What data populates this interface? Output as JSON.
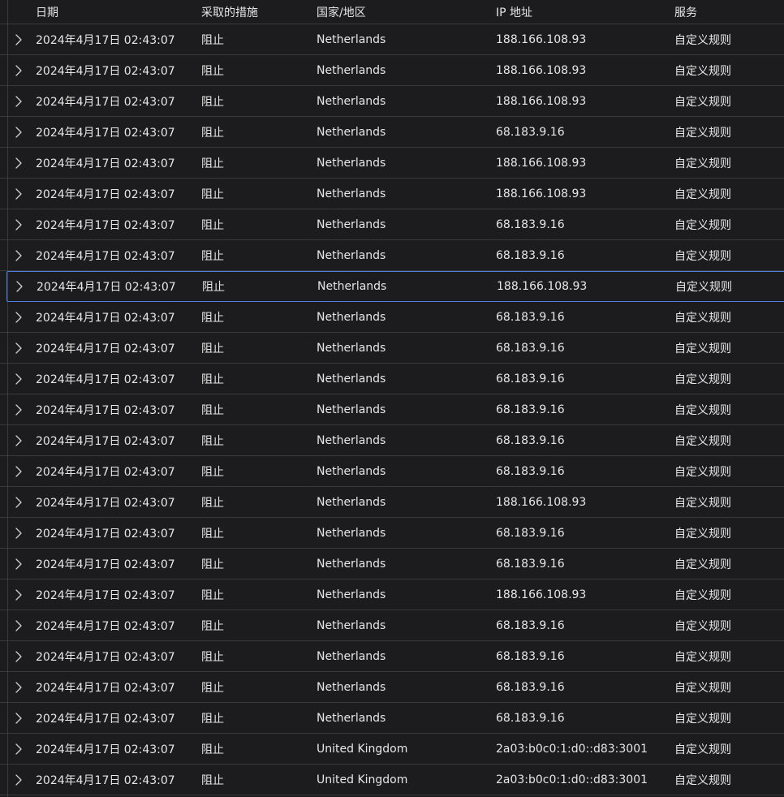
{
  "table": {
    "columns": {
      "date": "日期",
      "action": "采取的措施",
      "country": "国家/地区",
      "ip": "IP 地址",
      "service": "服务"
    },
    "selected_row_index": 8,
    "rows": [
      {
        "date": "2024年4月17日 02:43:07",
        "action": "阻止",
        "country": "Netherlands",
        "ip": "188.166.108.93",
        "service": "自定义规则"
      },
      {
        "date": "2024年4月17日 02:43:07",
        "action": "阻止",
        "country": "Netherlands",
        "ip": "188.166.108.93",
        "service": "自定义规则"
      },
      {
        "date": "2024年4月17日 02:43:07",
        "action": "阻止",
        "country": "Netherlands",
        "ip": "188.166.108.93",
        "service": "自定义规则"
      },
      {
        "date": "2024年4月17日 02:43:07",
        "action": "阻止",
        "country": "Netherlands",
        "ip": "68.183.9.16",
        "service": "自定义规则"
      },
      {
        "date": "2024年4月17日 02:43:07",
        "action": "阻止",
        "country": "Netherlands",
        "ip": "188.166.108.93",
        "service": "自定义规则"
      },
      {
        "date": "2024年4月17日 02:43:07",
        "action": "阻止",
        "country": "Netherlands",
        "ip": "188.166.108.93",
        "service": "自定义规则"
      },
      {
        "date": "2024年4月17日 02:43:07",
        "action": "阻止",
        "country": "Netherlands",
        "ip": "68.183.9.16",
        "service": "自定义规则"
      },
      {
        "date": "2024年4月17日 02:43:07",
        "action": "阻止",
        "country": "Netherlands",
        "ip": "68.183.9.16",
        "service": "自定义规则"
      },
      {
        "date": "2024年4月17日 02:43:07",
        "action": "阻止",
        "country": "Netherlands",
        "ip": "188.166.108.93",
        "service": "自定义规则"
      },
      {
        "date": "2024年4月17日 02:43:07",
        "action": "阻止",
        "country": "Netherlands",
        "ip": "68.183.9.16",
        "service": "自定义规则"
      },
      {
        "date": "2024年4月17日 02:43:07",
        "action": "阻止",
        "country": "Netherlands",
        "ip": "68.183.9.16",
        "service": "自定义规则"
      },
      {
        "date": "2024年4月17日 02:43:07",
        "action": "阻止",
        "country": "Netherlands",
        "ip": "68.183.9.16",
        "service": "自定义规则"
      },
      {
        "date": "2024年4月17日 02:43:07",
        "action": "阻止",
        "country": "Netherlands",
        "ip": "68.183.9.16",
        "service": "自定义规则"
      },
      {
        "date": "2024年4月17日 02:43:07",
        "action": "阻止",
        "country": "Netherlands",
        "ip": "68.183.9.16",
        "service": "自定义规则"
      },
      {
        "date": "2024年4月17日 02:43:07",
        "action": "阻止",
        "country": "Netherlands",
        "ip": "68.183.9.16",
        "service": "自定义规则"
      },
      {
        "date": "2024年4月17日 02:43:07",
        "action": "阻止",
        "country": "Netherlands",
        "ip": "188.166.108.93",
        "service": "自定义规则"
      },
      {
        "date": "2024年4月17日 02:43:07",
        "action": "阻止",
        "country": "Netherlands",
        "ip": "68.183.9.16",
        "service": "自定义规则"
      },
      {
        "date": "2024年4月17日 02:43:07",
        "action": "阻止",
        "country": "Netherlands",
        "ip": "68.183.9.16",
        "service": "自定义规则"
      },
      {
        "date": "2024年4月17日 02:43:07",
        "action": "阻止",
        "country": "Netherlands",
        "ip": "188.166.108.93",
        "service": "自定义规则"
      },
      {
        "date": "2024年4月17日 02:43:07",
        "action": "阻止",
        "country": "Netherlands",
        "ip": "68.183.9.16",
        "service": "自定义规则"
      },
      {
        "date": "2024年4月17日 02:43:07",
        "action": "阻止",
        "country": "Netherlands",
        "ip": "68.183.9.16",
        "service": "自定义规则"
      },
      {
        "date": "2024年4月17日 02:43:07",
        "action": "阻止",
        "country": "Netherlands",
        "ip": "68.183.9.16",
        "service": "自定义规则"
      },
      {
        "date": "2024年4月17日 02:43:07",
        "action": "阻止",
        "country": "Netherlands",
        "ip": "68.183.9.16",
        "service": "自定义规则"
      },
      {
        "date": "2024年4月17日 02:43:07",
        "action": "阻止",
        "country": "United Kingdom",
        "ip": "2a03:b0c0:1:d0::d83:3001",
        "service": "自定义规则"
      },
      {
        "date": "2024年4月17日 02:43:07",
        "action": "阻止",
        "country": "United Kingdom",
        "ip": "2a03:b0c0:1:d0::d83:3001",
        "service": "自定义规则"
      }
    ]
  },
  "colors": {
    "background": "#1c1c1e",
    "text": "#e6e6e6",
    "divider": "#3a3a3c",
    "selection_border": "#4c7fe0"
  },
  "icons": {
    "row_expander": "chevron-right-icon"
  }
}
